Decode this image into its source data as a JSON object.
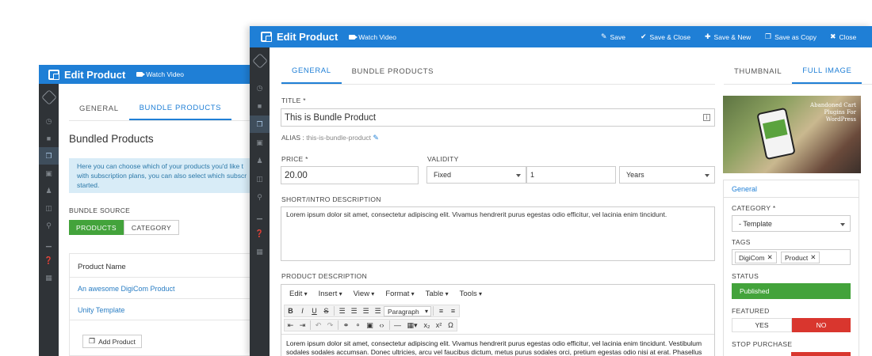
{
  "back_window": {
    "title": "Edit Product",
    "watch_video": "Watch Video",
    "tabs": [
      "GENERAL",
      "BUNDLE PRODUCTS"
    ],
    "section_title": "Bundled Products",
    "info_text": "Here you can choose which of your products you'd like t with subscription plans, you can also select which subscr started.",
    "bundle_source_label": "BUNDLE SOURCE",
    "source_buttons": [
      "PRODUCTS",
      "CATEGORY"
    ],
    "table_header": "Product Name",
    "rows": [
      "An awesome DigiCom Product",
      "Unity Template"
    ],
    "add_product": "Add Product"
  },
  "front_window": {
    "title": "Edit Product",
    "watch_video": "Watch Video",
    "toolbar": [
      "Save",
      "Save & Close",
      "Save & New",
      "Save as Copy",
      "Close"
    ],
    "tabs": [
      "GENERAL",
      "BUNDLE PRODUCTS"
    ],
    "right_tabs": [
      "THUMBNAIL",
      "FULL IMAGE"
    ],
    "title_label": "TITLE *",
    "title_value": "This is Bundle Product",
    "alias_label": "ALIAS :",
    "alias_value": "this-is-bundle-product",
    "price_label": "PRICE *",
    "price_value": "20.00",
    "validity_label": "VALIDITY",
    "validity_type": "Fixed",
    "validity_amount": "1",
    "validity_unit": "Years",
    "short_desc_label": "SHORT/INTRO DESCRIPTION",
    "short_desc_value": "Lorem ipsum dolor sit amet, consectetur adipiscing elit. Vivamus hendrerit purus egestas odio efficitur, vel lacinia enim tincidunt.",
    "product_desc_label": "PRODUCT DESCRIPTION",
    "editor_menu": [
      "Edit",
      "Insert",
      "View",
      "Format",
      "Table",
      "Tools"
    ],
    "editor_format": "Paragraph",
    "editor_text": "Lorem ipsum dolor sit amet, consectetur adipiscing elit. Vivamus hendrerit purus egestas odio efficitur, vel lacinia enim tincidunt. Vestibulum sodales sodales accumsan. Donec ultricies, arcu vel faucibus dictum, metus purus sodales orci, pretium egestas odio nisi at erat. Phasellus",
    "image_caption": "Abandoned Cart Plugins For WordPress",
    "panel_heading": "General",
    "category_label": "CATEGORY *",
    "category_value": "- Template",
    "tags_label": "TAGS",
    "tags": [
      "DigiCom",
      "Product"
    ],
    "status_label": "STATUS",
    "status_value": "Published",
    "featured_label": "FEATURED",
    "featured_yes": "YES",
    "featured_no": "NO",
    "stop_purchase_label": "STOP PURCHASE"
  },
  "colors": {
    "brand_blue": "#1f7fd6",
    "sidebar_dark": "#2f3337",
    "green": "#43a33b",
    "red": "#d9362e"
  }
}
